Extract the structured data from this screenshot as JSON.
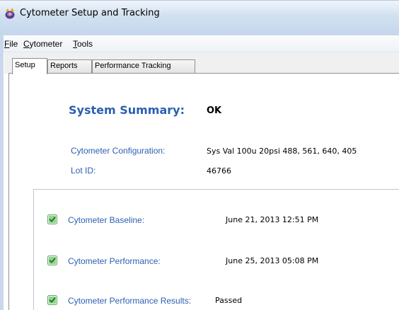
{
  "window": {
    "title": "Cytometer Setup and Tracking",
    "icon": "app-logo-icon"
  },
  "menu": {
    "items": [
      {
        "accel": "F",
        "rest": "ile"
      },
      {
        "accel": "C",
        "rest": "ytometer"
      },
      {
        "accel": "T",
        "rest": "ools"
      }
    ]
  },
  "tabs": [
    {
      "label": "Setup",
      "active": true
    },
    {
      "label": "Reports",
      "active": false
    },
    {
      "label": "Performance Tracking",
      "active": false
    }
  ],
  "summary": {
    "title": "System Summary:",
    "status": "OK",
    "config_label": "Cytometer Configuration:",
    "config_value": "Sys Val 100u 20psi 488, 561, 640, 405",
    "lot_label": "Lot ID:",
    "lot_value": "46766"
  },
  "checks": [
    {
      "label": "Cytometer Baseline:",
      "value": "June 21, 2013 12:51 PM",
      "icon": "check-icon",
      "passed": true
    },
    {
      "label": "Cytometer Performance:",
      "value": "June 25, 2013 05:08 PM",
      "icon": "check-icon",
      "passed": true
    },
    {
      "label": "Cytometer Performance Results:",
      "value": "Passed",
      "icon": "check-icon",
      "passed": true
    }
  ],
  "colors": {
    "label_blue": "#2b5fb2",
    "check_green": "#4caf50",
    "title_bar": "#cfdff0"
  }
}
